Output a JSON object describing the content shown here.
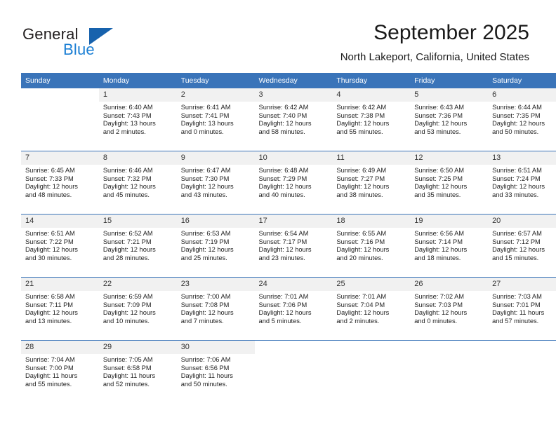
{
  "brand": {
    "name_part1": "General",
    "name_part2": "Blue",
    "accent_color": "#1762ad",
    "blue_text_color": "#1b7fd4"
  },
  "header": {
    "month_title": "September 2025",
    "location": "North Lakeport, California, United States"
  },
  "theme": {
    "header_row_bg": "#3a74b9",
    "daynum_bg": "#f1f1f1",
    "grid_line": "#3a74b9"
  },
  "calendar": {
    "weekday_headers": [
      "Sunday",
      "Monday",
      "Tuesday",
      "Wednesday",
      "Thursday",
      "Friday",
      "Saturday"
    ],
    "labels": {
      "sunrise": "Sunrise:",
      "sunset": "Sunset:",
      "daylight": "Daylight:"
    },
    "weeks": [
      [
        {
          "day": "",
          "sunrise": "",
          "sunset": "",
          "daylight1": "",
          "daylight2": ""
        },
        {
          "day": "1",
          "sunrise": "Sunrise: 6:40 AM",
          "sunset": "Sunset: 7:43 PM",
          "daylight1": "Daylight: 13 hours",
          "daylight2": "and 2 minutes."
        },
        {
          "day": "2",
          "sunrise": "Sunrise: 6:41 AM",
          "sunset": "Sunset: 7:41 PM",
          "daylight1": "Daylight: 13 hours",
          "daylight2": "and 0 minutes."
        },
        {
          "day": "3",
          "sunrise": "Sunrise: 6:42 AM",
          "sunset": "Sunset: 7:40 PM",
          "daylight1": "Daylight: 12 hours",
          "daylight2": "and 58 minutes."
        },
        {
          "day": "4",
          "sunrise": "Sunrise: 6:42 AM",
          "sunset": "Sunset: 7:38 PM",
          "daylight1": "Daylight: 12 hours",
          "daylight2": "and 55 minutes."
        },
        {
          "day": "5",
          "sunrise": "Sunrise: 6:43 AM",
          "sunset": "Sunset: 7:36 PM",
          "daylight1": "Daylight: 12 hours",
          "daylight2": "and 53 minutes."
        },
        {
          "day": "6",
          "sunrise": "Sunrise: 6:44 AM",
          "sunset": "Sunset: 7:35 PM",
          "daylight1": "Daylight: 12 hours",
          "daylight2": "and 50 minutes."
        }
      ],
      [
        {
          "day": "7",
          "sunrise": "Sunrise: 6:45 AM",
          "sunset": "Sunset: 7:33 PM",
          "daylight1": "Daylight: 12 hours",
          "daylight2": "and 48 minutes."
        },
        {
          "day": "8",
          "sunrise": "Sunrise: 6:46 AM",
          "sunset": "Sunset: 7:32 PM",
          "daylight1": "Daylight: 12 hours",
          "daylight2": "and 45 minutes."
        },
        {
          "day": "9",
          "sunrise": "Sunrise: 6:47 AM",
          "sunset": "Sunset: 7:30 PM",
          "daylight1": "Daylight: 12 hours",
          "daylight2": "and 43 minutes."
        },
        {
          "day": "10",
          "sunrise": "Sunrise: 6:48 AM",
          "sunset": "Sunset: 7:29 PM",
          "daylight1": "Daylight: 12 hours",
          "daylight2": "and 40 minutes."
        },
        {
          "day": "11",
          "sunrise": "Sunrise: 6:49 AM",
          "sunset": "Sunset: 7:27 PM",
          "daylight1": "Daylight: 12 hours",
          "daylight2": "and 38 minutes."
        },
        {
          "day": "12",
          "sunrise": "Sunrise: 6:50 AM",
          "sunset": "Sunset: 7:25 PM",
          "daylight1": "Daylight: 12 hours",
          "daylight2": "and 35 minutes."
        },
        {
          "day": "13",
          "sunrise": "Sunrise: 6:51 AM",
          "sunset": "Sunset: 7:24 PM",
          "daylight1": "Daylight: 12 hours",
          "daylight2": "and 33 minutes."
        }
      ],
      [
        {
          "day": "14",
          "sunrise": "Sunrise: 6:51 AM",
          "sunset": "Sunset: 7:22 PM",
          "daylight1": "Daylight: 12 hours",
          "daylight2": "and 30 minutes."
        },
        {
          "day": "15",
          "sunrise": "Sunrise: 6:52 AM",
          "sunset": "Sunset: 7:21 PM",
          "daylight1": "Daylight: 12 hours",
          "daylight2": "and 28 minutes."
        },
        {
          "day": "16",
          "sunrise": "Sunrise: 6:53 AM",
          "sunset": "Sunset: 7:19 PM",
          "daylight1": "Daylight: 12 hours",
          "daylight2": "and 25 minutes."
        },
        {
          "day": "17",
          "sunrise": "Sunrise: 6:54 AM",
          "sunset": "Sunset: 7:17 PM",
          "daylight1": "Daylight: 12 hours",
          "daylight2": "and 23 minutes."
        },
        {
          "day": "18",
          "sunrise": "Sunrise: 6:55 AM",
          "sunset": "Sunset: 7:16 PM",
          "daylight1": "Daylight: 12 hours",
          "daylight2": "and 20 minutes."
        },
        {
          "day": "19",
          "sunrise": "Sunrise: 6:56 AM",
          "sunset": "Sunset: 7:14 PM",
          "daylight1": "Daylight: 12 hours",
          "daylight2": "and 18 minutes."
        },
        {
          "day": "20",
          "sunrise": "Sunrise: 6:57 AM",
          "sunset": "Sunset: 7:12 PM",
          "daylight1": "Daylight: 12 hours",
          "daylight2": "and 15 minutes."
        }
      ],
      [
        {
          "day": "21",
          "sunrise": "Sunrise: 6:58 AM",
          "sunset": "Sunset: 7:11 PM",
          "daylight1": "Daylight: 12 hours",
          "daylight2": "and 13 minutes."
        },
        {
          "day": "22",
          "sunrise": "Sunrise: 6:59 AM",
          "sunset": "Sunset: 7:09 PM",
          "daylight1": "Daylight: 12 hours",
          "daylight2": "and 10 minutes."
        },
        {
          "day": "23",
          "sunrise": "Sunrise: 7:00 AM",
          "sunset": "Sunset: 7:08 PM",
          "daylight1": "Daylight: 12 hours",
          "daylight2": "and 7 minutes."
        },
        {
          "day": "24",
          "sunrise": "Sunrise: 7:01 AM",
          "sunset": "Sunset: 7:06 PM",
          "daylight1": "Daylight: 12 hours",
          "daylight2": "and 5 minutes."
        },
        {
          "day": "25",
          "sunrise": "Sunrise: 7:01 AM",
          "sunset": "Sunset: 7:04 PM",
          "daylight1": "Daylight: 12 hours",
          "daylight2": "and 2 minutes."
        },
        {
          "day": "26",
          "sunrise": "Sunrise: 7:02 AM",
          "sunset": "Sunset: 7:03 PM",
          "daylight1": "Daylight: 12 hours",
          "daylight2": "and 0 minutes."
        },
        {
          "day": "27",
          "sunrise": "Sunrise: 7:03 AM",
          "sunset": "Sunset: 7:01 PM",
          "daylight1": "Daylight: 11 hours",
          "daylight2": "and 57 minutes."
        }
      ],
      [
        {
          "day": "28",
          "sunrise": "Sunrise: 7:04 AM",
          "sunset": "Sunset: 7:00 PM",
          "daylight1": "Daylight: 11 hours",
          "daylight2": "and 55 minutes."
        },
        {
          "day": "29",
          "sunrise": "Sunrise: 7:05 AM",
          "sunset": "Sunset: 6:58 PM",
          "daylight1": "Daylight: 11 hours",
          "daylight2": "and 52 minutes."
        },
        {
          "day": "30",
          "sunrise": "Sunrise: 7:06 AM",
          "sunset": "Sunset: 6:56 PM",
          "daylight1": "Daylight: 11 hours",
          "daylight2": "and 50 minutes."
        },
        {
          "day": "",
          "sunrise": "",
          "sunset": "",
          "daylight1": "",
          "daylight2": ""
        },
        {
          "day": "",
          "sunrise": "",
          "sunset": "",
          "daylight1": "",
          "daylight2": ""
        },
        {
          "day": "",
          "sunrise": "",
          "sunset": "",
          "daylight1": "",
          "daylight2": ""
        },
        {
          "day": "",
          "sunrise": "",
          "sunset": "",
          "daylight1": "",
          "daylight2": ""
        }
      ]
    ]
  }
}
